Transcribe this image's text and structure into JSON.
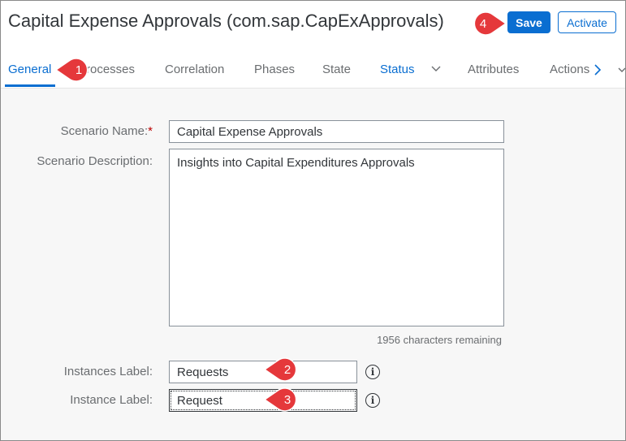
{
  "header": {
    "title": "Capital Expense Approvals (com.sap.CapExApprovals)",
    "save_label": "Save",
    "activate_label": "Activate"
  },
  "tabs": [
    {
      "label": "General",
      "selected": true
    },
    {
      "label": "Processes"
    },
    {
      "label": "Correlation"
    },
    {
      "label": "Phases"
    },
    {
      "label": "State"
    },
    {
      "label": "Status",
      "has_dropdown": true
    },
    {
      "label": "Attributes"
    },
    {
      "label": "Actions"
    }
  ],
  "form": {
    "scenario_name_label": "Scenario Name:",
    "required_mark": "*",
    "scenario_name_value": "Capital Expense Approvals",
    "scenario_description_label": "Scenario Description:",
    "scenario_description_value": "Insights into Capital Expenditures Approvals",
    "characters_remaining": "1956 characters remaining",
    "instances_label_label": "Instances Label:",
    "instances_label_value": "Requests",
    "instance_label_label": "Instance Label:",
    "instance_label_value": "Request"
  },
  "annotations": [
    "1",
    "2",
    "3",
    "4"
  ],
  "colors": {
    "accent": "#0a6ed1",
    "annotation": "#e5383b",
    "required": "#bb0000"
  },
  "icons": {
    "tab_overflow": "chevron-down-icon",
    "scroll_tabs": "chevron-right-icon",
    "field_help": "info-icon"
  }
}
